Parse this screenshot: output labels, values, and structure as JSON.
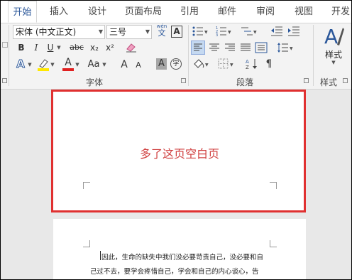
{
  "tabs": [
    "开始",
    "插入",
    "设计",
    "页面布局",
    "引用",
    "邮件",
    "审阅",
    "视图",
    "开发"
  ],
  "font": {
    "name": "宋体 (中文正文)",
    "size": "三号",
    "wen_label": "wén",
    "wen_char": "文",
    "a_char": "A",
    "bold": "B",
    "italic": "I",
    "underline": "U",
    "strike": "abc",
    "subscript": "x₂",
    "superscript": "x²",
    "case": "Aa",
    "grow": "A",
    "shrink": "A",
    "shade_char": "A",
    "circle_char": "字",
    "effect_char": "A",
    "color_char": "A",
    "group_label": "字体"
  },
  "paragraph": {
    "group_label": "段落"
  },
  "styles": {
    "button_label": "样式",
    "group_label": "样式"
  },
  "document": {
    "blank_note": "多了这页空白页",
    "line1": "因此，生命的缺失中我们没必要苛责自己，没必要和自",
    "line2": "己过不去，要学会疼惜自己，学会和自己的内心谈心，告"
  },
  "colors": {
    "accent": "#2b579a",
    "highlight_box": "#e03030",
    "highlight_text": "#d04040",
    "font_color": "#e02020",
    "highlighter": "#ffe800"
  }
}
